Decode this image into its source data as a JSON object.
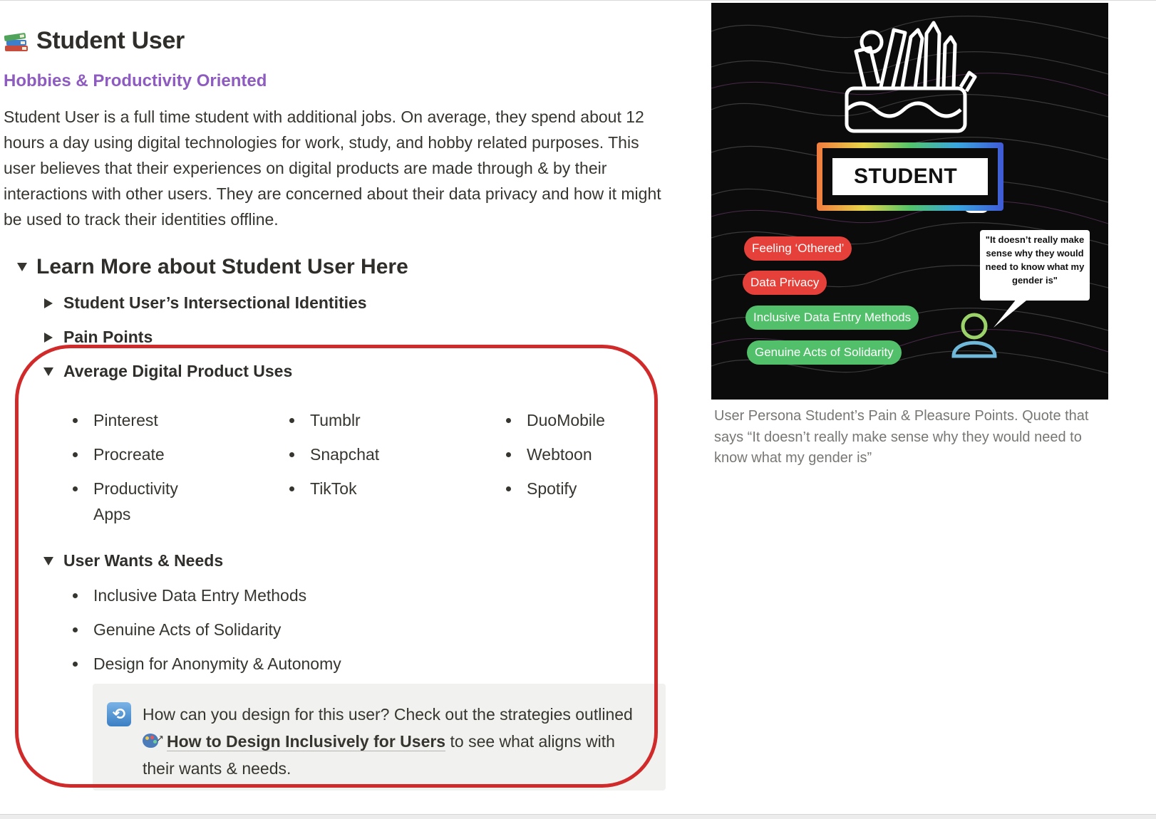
{
  "page": {
    "title": "Student User",
    "subtitle": "Hobbies & Productivity Oriented",
    "description": "Student User is a full time student with additional jobs. On average, they spend about 12 hours a day using digital technologies for work, study, and hobby related purposes.  This user believes that their experiences on digital products are made through & by their interactions with other users. They are concerned about their data privacy and how it might be used to track their identities offline.",
    "title_icon": "books-icon"
  },
  "learn_more": {
    "heading": "Learn More about Student User Here",
    "expanded": true,
    "sections": [
      {
        "label": "Student User’s Intersectional Identities",
        "expanded": false
      },
      {
        "label": "Pain Points",
        "expanded": false
      },
      {
        "label": "Average Digital Product Uses",
        "expanded": true
      },
      {
        "label": "User Wants & Needs",
        "expanded": true
      }
    ]
  },
  "product_uses": {
    "col1": [
      "Pinterest",
      "Procreate",
      "Productivity Apps"
    ],
    "col2": [
      "Tumblr",
      "Snapchat",
      "TikTok"
    ],
    "col3": [
      "DuoMobile",
      "Webtoon",
      "Spotify"
    ]
  },
  "wants_needs": [
    "Inclusive Data Entry Methods",
    "Genuine Acts of Solidarity",
    "Design for Anonymity & Autonomy"
  ],
  "callout": {
    "icon": "repeat-icon",
    "text_before": "How can you design for this user? Check out the strategies outlined ",
    "link_icon": "palette-link-icon",
    "link_text": "How to Design Inclusively for Users",
    "text_after": " to see what aligns with their wants & needs."
  },
  "poster": {
    "label": "STUDENT",
    "pills_red": [
      "Feeling ‘Othered’",
      "Data Privacy"
    ],
    "pills_green": [
      "Inclusive Data Entry Methods",
      "Genuine Acts of Solidarity"
    ],
    "quote": "\"It doesn’t really make sense why they would need to know what my gender is\"",
    "colors": {
      "red": "#e5413a",
      "green": "#52c06a",
      "background": "#0b0b0b"
    }
  },
  "caption": "User Persona Student’s Pain & Pleasure Points. Quote that says “It doesn’t really make sense why they would need to know what my gender is”",
  "colors": {
    "subtitle": "#8e5cc1",
    "highlight": "#d12a2a",
    "text": "#37352f",
    "caption": "#787774",
    "callout_bg": "#f1f1ef"
  }
}
